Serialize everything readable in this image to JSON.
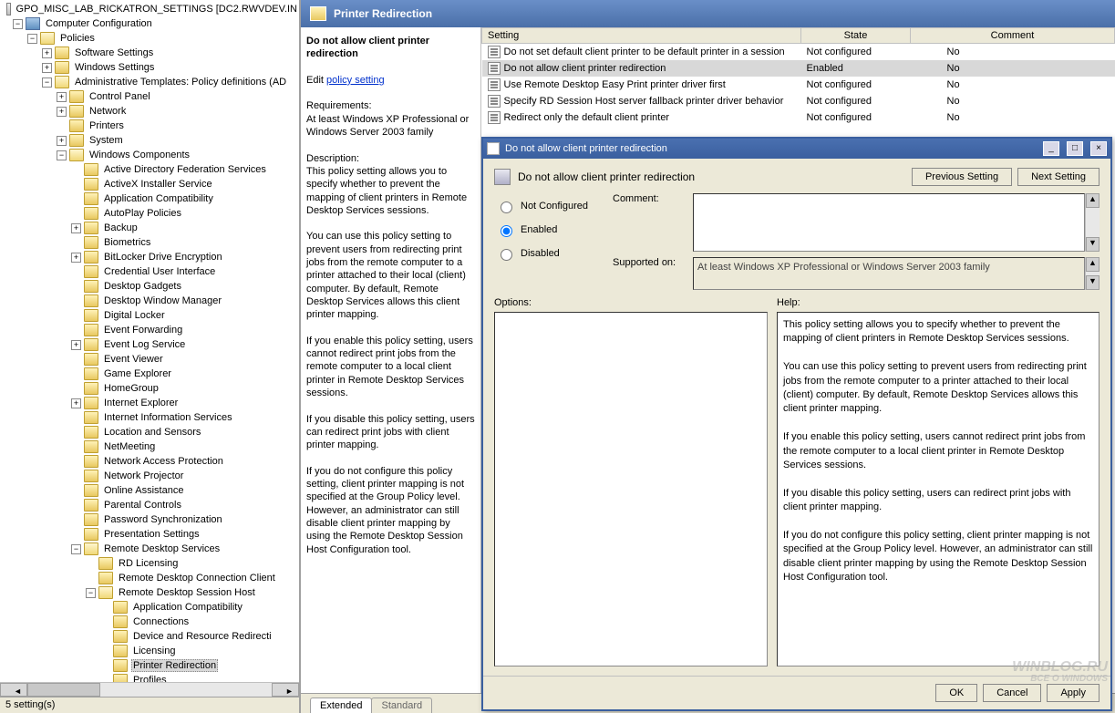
{
  "tree": {
    "root": "GPO_MISC_LAB_RICKATRON_SETTINGS [DC2.RWVDEV.IN",
    "computer_config": "Computer Configuration",
    "policies": "Policies",
    "software_settings": "Software Settings",
    "windows_settings": "Windows Settings",
    "admin_templates": "Administrative Templates: Policy definitions (AD",
    "control_panel": "Control Panel",
    "network": "Network",
    "printers": "Printers",
    "system": "System",
    "windows_components": "Windows Components",
    "wc": {
      "adfs": "Active Directory Federation Services",
      "activex": "ActiveX Installer Service",
      "appcompat": "Application Compatibility",
      "autoplay": "AutoPlay Policies",
      "backup": "Backup",
      "biometrics": "Biometrics",
      "bitlocker": "BitLocker Drive Encryption",
      "credui": "Credential User Interface",
      "gadgets": "Desktop Gadgets",
      "dwm": "Desktop Window Manager",
      "digilocker": "Digital Locker",
      "eventfwd": "Event Forwarding",
      "eventlog": "Event Log Service",
      "eventviewer": "Event Viewer",
      "gameexp": "Game Explorer",
      "homegroup": "HomeGroup",
      "ie": "Internet Explorer",
      "iis": "Internet Information Services",
      "locsensors": "Location and Sensors",
      "netmeeting": "NetMeeting",
      "nap": "Network Access Protection",
      "netproj": "Network Projector",
      "onlineassist": "Online Assistance",
      "parental": "Parental Controls",
      "pwdsync": "Password Synchronization",
      "presentation": "Presentation Settings",
      "rds": "Remote Desktop Services",
      "rdlicensing": "RD Licensing",
      "rdcclient": "Remote Desktop Connection Client",
      "rdsh": "Remote Desktop Session Host",
      "rdsh_appcompat": "Application Compatibility",
      "rdsh_conn": "Connections",
      "rdsh_device": "Device and Resource Redirecti",
      "rdsh_licensing": "Licensing",
      "rdsh_printer": "Printer Redirection",
      "rdsh_profiles": "Profiles"
    }
  },
  "statusbar": "5 setting(s)",
  "header": "Printer Redirection",
  "desc": {
    "title": "Do not allow client printer redirection",
    "edit_prefix": "Edit ",
    "edit_link": "policy setting",
    "req_label": "Requirements:",
    "req_text": "At least Windows XP Professional or Windows Server 2003 family",
    "desc_label": "Description:",
    "p1": "This policy setting allows you to specify whether to prevent the mapping of client printers in Remote Desktop Services sessions.",
    "p2": "You can use this policy setting to prevent users from redirecting print jobs from the remote computer to a printer attached to their local (client) computer. By default, Remote Desktop Services allows this client printer mapping.",
    "p3": "If you enable this policy setting, users cannot redirect print jobs from the remote computer to a local client printer in Remote Desktop Services sessions.",
    "p4": "If you disable this policy setting, users can redirect print jobs with client printer mapping.",
    "p5": "If you do not configure this policy setting, client printer mapping is not specified at the Group Policy level. However, an administrator can still disable client printer mapping by using the Remote Desktop Session Host Configuration tool."
  },
  "table": {
    "cols": {
      "setting": "Setting",
      "state": "State",
      "comment": "Comment"
    },
    "rows": [
      {
        "s": "Do not set default client printer to be default printer in a session",
        "st": "Not configured",
        "c": "No"
      },
      {
        "s": "Do not allow client printer redirection",
        "st": "Enabled",
        "c": "No"
      },
      {
        "s": "Use Remote Desktop Easy Print printer driver first",
        "st": "Not configured",
        "c": "No"
      },
      {
        "s": "Specify RD Session Host server fallback printer driver behavior",
        "st": "Not configured",
        "c": "No"
      },
      {
        "s": "Redirect only the default client printer",
        "st": "Not configured",
        "c": "No"
      }
    ]
  },
  "tabs": {
    "extended": "Extended",
    "standard": "Standard"
  },
  "dialog": {
    "title": "Do not allow client printer redirection",
    "heading": "Do not allow client printer redirection",
    "prev": "Previous Setting",
    "next": "Next Setting",
    "radio": {
      "nc": "Not Configured",
      "en": "Enabled",
      "dis": "Disabled"
    },
    "comment_label": "Comment:",
    "supported_label": "Supported on:",
    "supported_text": "At least Windows XP Professional or Windows Server 2003 family",
    "options_label": "Options:",
    "help_label": "Help:",
    "help_text": "This policy setting allows you to specify whether to prevent the mapping of client printers in Remote Desktop Services sessions.\n\nYou can use this policy setting to prevent users from redirecting print jobs from the remote computer to a printer attached to their local (client) computer. By default, Remote Desktop Services allows this client printer mapping.\n\nIf you enable this policy setting, users cannot redirect print jobs from the remote computer to a local client printer in Remote Desktop Services sessions.\n\nIf you disable this policy setting, users can redirect print jobs with client printer mapping.\n\nIf you do not configure this policy setting, client printer mapping is not specified at the Group Policy level. However, an administrator can still disable client printer mapping by using the Remote Desktop Session Host Configuration tool.",
    "ok": "OK",
    "cancel": "Cancel",
    "apply": "Apply"
  },
  "watermark": {
    "l1": "WINBLOG.RU",
    "l2": "ВСЕ О WINDOWS"
  }
}
